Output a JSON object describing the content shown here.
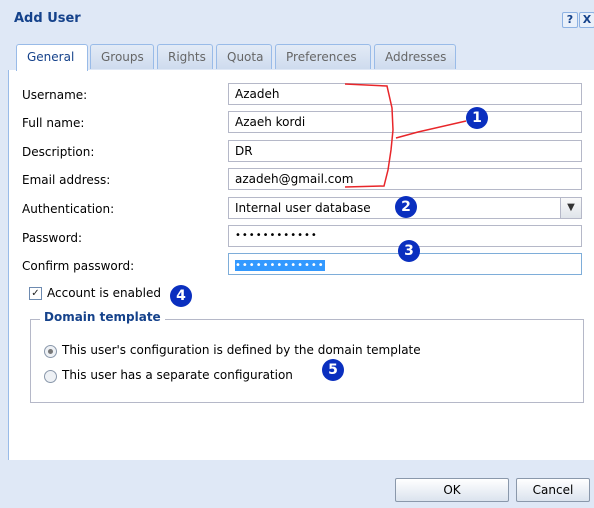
{
  "window": {
    "title": "Add User",
    "help_label": "?",
    "close_label": "X"
  },
  "tabs": [
    "General",
    "Groups",
    "Rights",
    "Quota",
    "Preferences",
    "Addresses"
  ],
  "form": {
    "username_label": "Username:",
    "username_value": "Azadeh",
    "fullname_label": "Full name:",
    "fullname_value": "Azaeh kordi",
    "description_label": "Description:",
    "description_value": "DR",
    "email_label": "Email address:",
    "email_value": "azadeh@gmail.com",
    "auth_label": "Authentication:",
    "auth_value": "Internal user database",
    "password_label": "Password:",
    "password_value": "••••••••••••",
    "confirm_label": "Confirm password:",
    "confirm_value": "•••••••••••••"
  },
  "account_enabled": {
    "label": "Account is enabled",
    "checked": true,
    "check_glyph": "✓"
  },
  "domain_template": {
    "legend": "Domain template",
    "option1": "This user's configuration is defined by the domain template",
    "option2": "This user has a separate configuration",
    "selected": 1
  },
  "annotations": [
    "1",
    "2",
    "3",
    "4",
    "5"
  ],
  "buttons": {
    "ok": "OK",
    "cancel": "Cancel"
  },
  "colors": {
    "accent": "#15428b",
    "badge": "#0a2fbf",
    "annotation_line": "#e8262a",
    "selection": "#3399ff"
  }
}
